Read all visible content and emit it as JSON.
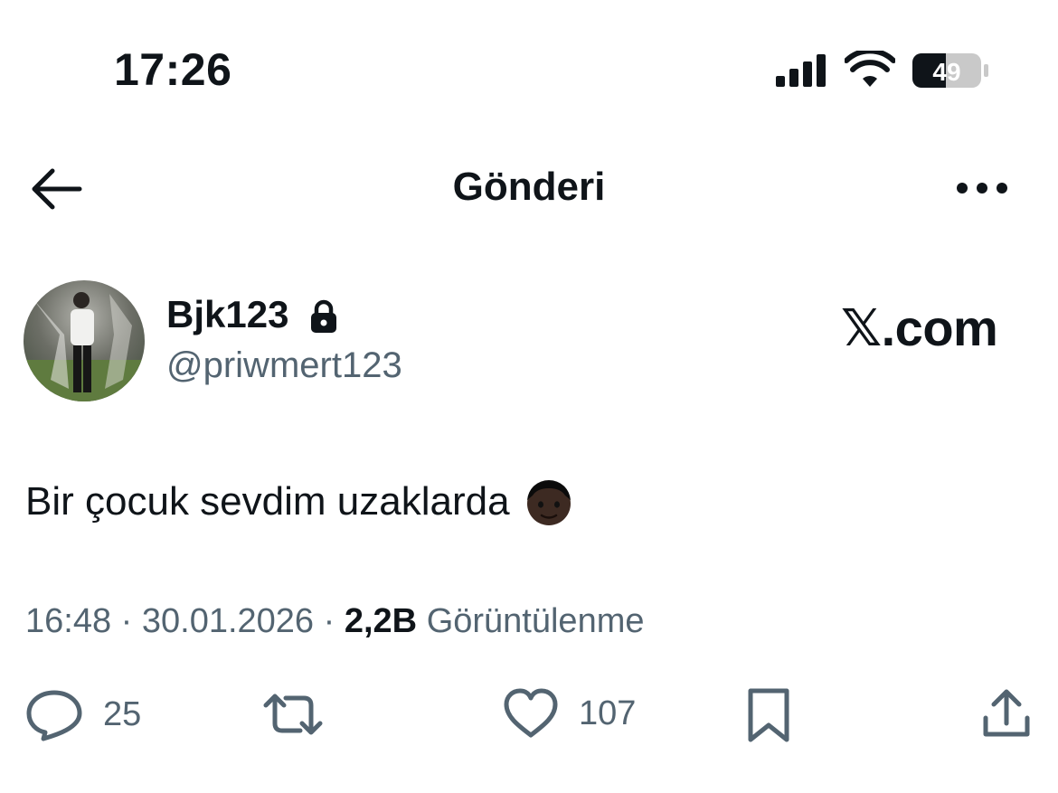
{
  "status_bar": {
    "time": "17:26",
    "battery_level": "49",
    "icons": [
      "signal-icon",
      "wifi-icon",
      "battery-icon"
    ]
  },
  "header": {
    "title": "Gönderi",
    "back_icon": "arrow-left-icon",
    "more_icon": "more-horizontal-icon"
  },
  "author": {
    "display_name": "Bjk123",
    "handle": "@priwmert123",
    "protected_icon": "lock-icon"
  },
  "brand": {
    "text": "𝕏.com"
  },
  "tweet": {
    "text": "Bir çocuk sevdim uzaklarda",
    "emoji_icon": "man-dark-skin-emoji"
  },
  "meta": {
    "time": "16:48",
    "separator": "·",
    "date": "30.01.2026",
    "views_count": "2,2B",
    "views_label": "Görüntülenme"
  },
  "actions": {
    "reply_count": "25",
    "like_count": "107"
  },
  "colors": {
    "text": "#0f1419",
    "secondary": "#536471",
    "background": "#ffffff"
  }
}
